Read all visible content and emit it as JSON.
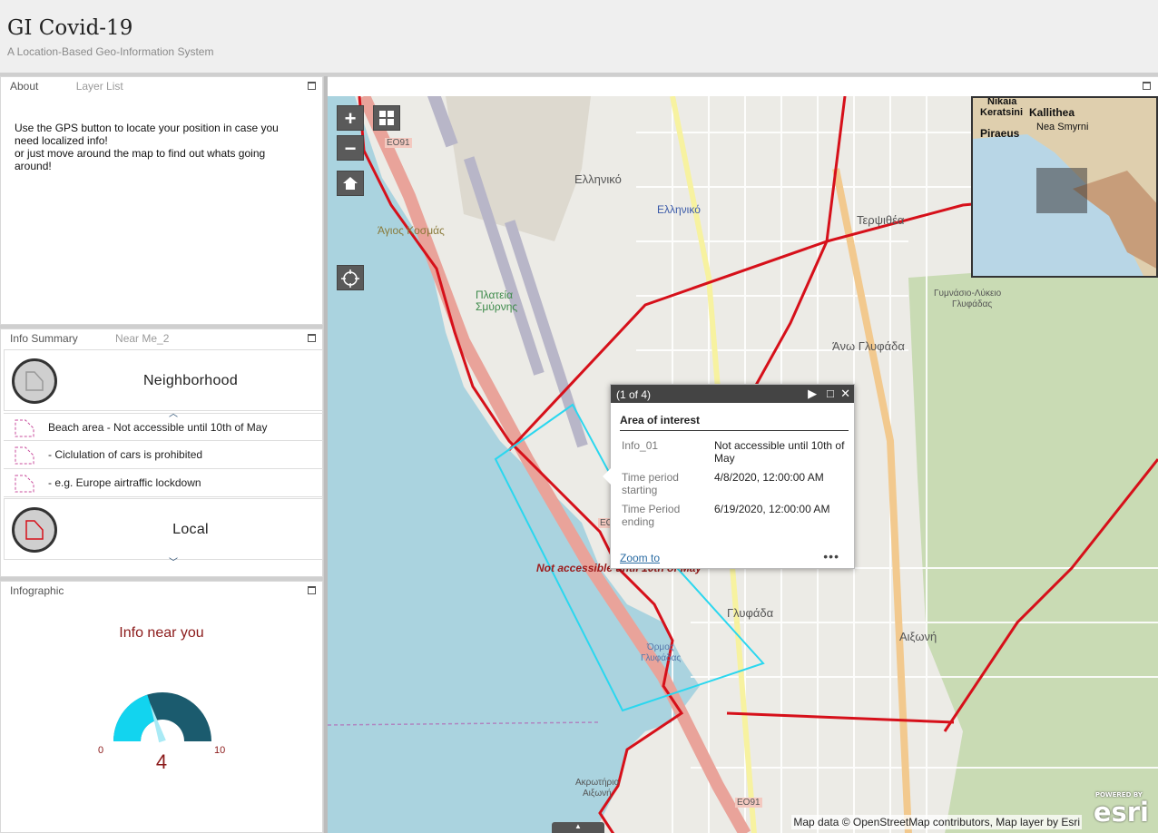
{
  "app": {
    "title": "GI Covid-19",
    "subtitle": "A Location-Based Geo-Information System"
  },
  "about_panel": {
    "tabs": [
      "About",
      "Layer List"
    ],
    "text_lines": [
      "Use the GPS button to locate your position in case you",
      "need localized info!",
      "or just move around the map to find out whats going",
      "around!"
    ]
  },
  "info_panel": {
    "tabs": [
      "Info Summary",
      "Near Me_2"
    ],
    "neighborhood_label": "Neighborhood",
    "items": [
      "Beach area - Not accessible until 10th of May",
      "- Ciclulation of cars is prohibited",
      "- e.g. Europe airtraffic lockdown"
    ],
    "local_label": "Local"
  },
  "infographic_panel": {
    "tab": "Infographic",
    "title": "Info near you",
    "gauge": {
      "min": "0",
      "max": "10",
      "value": "4",
      "value_num": 4
    },
    "colors": {
      "filled": "#12d4ef",
      "track": "#1b5b6e"
    }
  },
  "map": {
    "labels": {
      "airport": "Ελληνικό",
      "metro": "Ελληνικό",
      "agios_kosmas": "Άγιος Κοσμάς",
      "plateia": "Πλατεία",
      "smyrnis": "Σμύρνης",
      "terpsithea": "Τερψιθέα",
      "ano_glyfada": "Άνω Γλυφάδα",
      "glyfada": "Γλυφάδα",
      "aixoni": "Αιξωνή",
      "ormos1": "Όρμος",
      "ormos2": "Γλυφάδας",
      "akrotirio1": "Ακρωτήριο",
      "akrotirio2": "Αιξωνή",
      "gym1": "Γυμνάσιο-Λύκειο",
      "gym2": "Γλυφάδας",
      "eo91_top": "ΕΟ91",
      "eo91_bottom": "ΕΟ91",
      "eo91_mid": "ΕΟ"
    },
    "red_label": "Not accessible until 10th of May",
    "overview_labels": {
      "nikaia": "Nikaia",
      "keratsini": "Keratsini",
      "kallithea": "Kallithea",
      "nea_smyrni": "Nea Smyrni",
      "piraeus": "Piraeus"
    },
    "attribution": "Map data © OpenStreetMap contributors, Map layer by Esri",
    "powered_by": "POWERED BY",
    "esri": "esri",
    "colors": {
      "boundary": "#d6101a",
      "interest_area": "#2ad7ef",
      "sea": "#aad3df",
      "land": "#ecebe6",
      "road_major": "#e9a39a"
    }
  },
  "popup": {
    "pager": "(1 of 4)",
    "title": "Area of interest",
    "fields": [
      {
        "key": "Info_01",
        "value": "Not accessible until 10th of May"
      },
      {
        "key": "Time period starting",
        "value": "4/8/2020, 12:00:00 AM"
      },
      {
        "key": "Time Period ending",
        "value": "6/19/2020, 12:00:00 AM"
      }
    ],
    "zoom_link": "Zoom to",
    "more": "•••"
  }
}
